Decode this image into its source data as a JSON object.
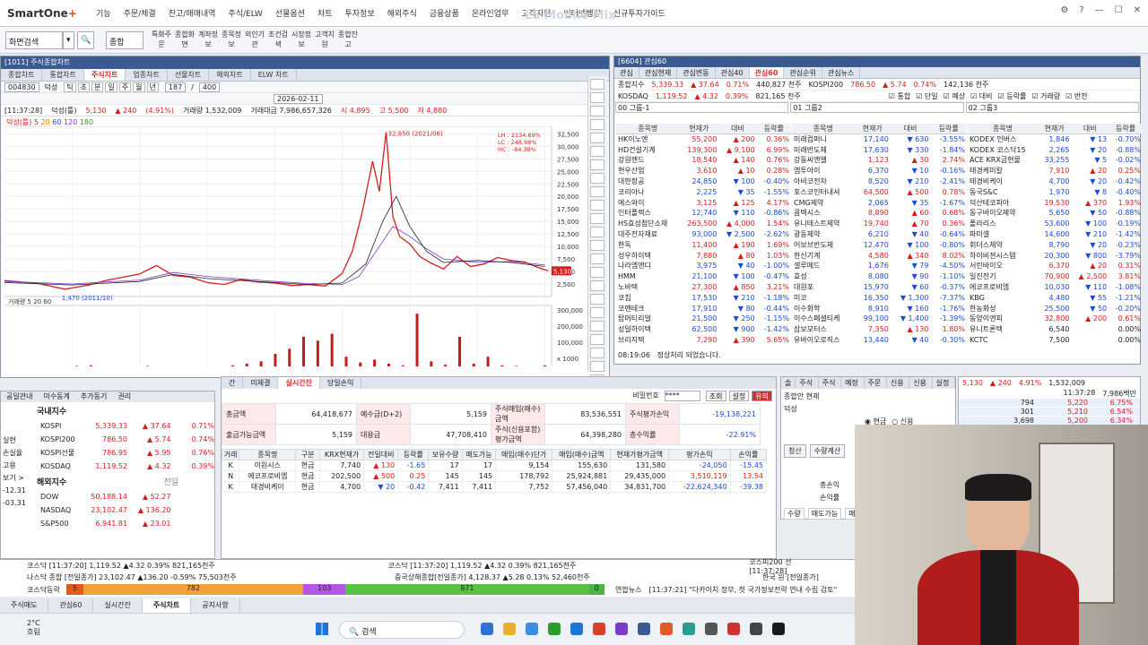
{
  "app": {
    "logo_main": "SmartOne",
    "logo_plus": "+",
    "watermark": "LS Mobile Mix",
    "menu": [
      "기능",
      "주문/체결",
      "잔고/매매내역",
      "주식/ELW",
      "선물옵션",
      "차트",
      "투자정보",
      "해외주식",
      "금융상품",
      "온라인업무",
      "고객지원",
      "인터넷뱅킹",
      "신규투자가이드"
    ]
  },
  "toolbar": {
    "screen_search": "화면검색",
    "combined": "종합",
    "buttons": [
      "특화주문",
      "종합화면",
      "계좌정보",
      "종목정보",
      "외인기관",
      "조건검색",
      "시장정보",
      "고객지원",
      "종합잔고"
    ]
  },
  "chart_window": {
    "title": "[1011] 주식종합차트",
    "tabs": [
      "종합차트",
      "통합차트",
      "주식차트",
      "업종차트",
      "선물차트",
      "해외차트",
      "ELW 차트"
    ],
    "active_tab": "주식차트",
    "stock_code": "004830",
    "stock_name": "덕성",
    "period_buttons": [
      "틱",
      "초",
      "분",
      "일",
      "주",
      "월",
      "년"
    ],
    "count": "187",
    "total": "400",
    "date": "2026-02-11",
    "time": "[11:37:28]",
    "legend": "덕성(틀)",
    "ma_legend": [
      "5",
      "20",
      "60",
      "120",
      "180"
    ],
    "price": "5,130",
    "change": "▲ 240",
    "change_pct": "(4.91%)",
    "volume_label": "거래량 1,532,009",
    "amount_label": "거래대금 7,986,657,326",
    "open": "시 4,895",
    "high": "고 5,500",
    "low": "저 4,880",
    "high_marker": "32,850 (2021/06)",
    "low_marker": "1,470 (2011/10)",
    "lh_box": [
      "LH : 2134.69%",
      "LC : 248.98%",
      "HC : -84.38%"
    ],
    "vol_legend": "거래량",
    "vol_ma": [
      "5",
      "20",
      "60"
    ]
  },
  "chart_data": {
    "type": "line",
    "title": "덕성(틀)",
    "x_ticks": [
      "2010",
      "2012",
      "2014",
      "2016",
      "2018",
      "2020",
      "2022",
      "2024",
      "2026"
    ],
    "y_ticks": [
      32500,
      30000,
      27500,
      25000,
      22500,
      20000,
      17500,
      15000,
      12500,
      10000,
      7500,
      5000,
      2500
    ],
    "vol_ticks": [
      "300,000",
      "200,000",
      "100,000",
      "x 1000"
    ],
    "ylim": [
      0,
      34000
    ],
    "series": [
      {
        "name": "덕성(틀)",
        "x": [
          2010,
          2011,
          2011.8,
          2012.5,
          2013,
          2014,
          2014.5,
          2015,
          2015.5,
          2016,
          2016.5,
          2017,
          2017.5,
          2018,
          2018.5,
          2019,
          2019.5,
          2020,
          2020.3,
          2020.6,
          2020.9,
          2021.1,
          2021.3,
          2021.5,
          2021.7,
          2022,
          2022.3,
          2022.6,
          2023,
          2023.4,
          2023.8,
          2024.2,
          2024.6,
          2025,
          2025.4,
          2025.8,
          2026.1
        ],
        "values": [
          3200,
          2600,
          1470,
          2300,
          3200,
          4500,
          6200,
          4200,
          3900,
          2800,
          2400,
          3400,
          2900,
          2700,
          2200,
          2400,
          2100,
          4600,
          9000,
          17000,
          27000,
          21000,
          32850,
          16000,
          12000,
          10500,
          8000,
          6800,
          5500,
          8000,
          6000,
          6500,
          7800,
          7200,
          6900,
          5800,
          5130
        ]
      },
      {
        "name": "120",
        "x": [
          2010,
          2012,
          2014,
          2015,
          2016,
          2018,
          2019,
          2020,
          2020.5,
          2021,
          2021.5,
          2022,
          2022.5,
          2023,
          2024,
          2025,
          2026
        ],
        "values": [
          3000,
          2500,
          3300,
          4800,
          4000,
          3000,
          2600,
          2400,
          4000,
          9000,
          14000,
          12000,
          9500,
          7500,
          6800,
          7000,
          6300
        ]
      },
      {
        "name": "60",
        "x": [
          2010,
          2012,
          2014,
          2015,
          2016,
          2018,
          2019,
          2020,
          2020.7,
          2021.2,
          2021.6,
          2022,
          2022.5,
          2023,
          2024,
          2025,
          2026
        ],
        "values": [
          2800,
          2300,
          3000,
          4400,
          3600,
          2800,
          2400,
          2700,
          6500,
          15000,
          20000,
          14000,
          9000,
          6800,
          7200,
          6800,
          6000
        ]
      }
    ],
    "volume": [
      0.02,
      0.01,
      0.02,
      0.03,
      0.02,
      0.04,
      0.05,
      0.03,
      0.02,
      0.03,
      0.04,
      0.02,
      0.03,
      0.02,
      0.03,
      0.03,
      0.05,
      0.08,
      0.12,
      0.25,
      0.34,
      0.55,
      0.48,
      0.6,
      0.2,
      0.1,
      0.15,
      0.08,
      0.05,
      0.95,
      0.12,
      0.06,
      0.55,
      0.08,
      0.2,
      0.05,
      0.04,
      0.03,
      0.05
    ]
  },
  "watch_window": {
    "title": "[6604] 관심60",
    "tabs": [
      "관심",
      "관심현재",
      "관심변동",
      "관심40",
      "관심60",
      "관심순위",
      "관심뉴스"
    ],
    "active_tab": "관심60",
    "idx1": {
      "name": "종합지수",
      "val": "5,339.33",
      "chg": "▲ 37.64",
      "pct": "0.71%",
      "vol": "440,827 천주",
      "name2": "KOSPI200",
      "val2": "786.50",
      "chg2": "▲ 5.74",
      "pct2": "0.74%",
      "vol2": "142,136 천주"
    },
    "idx2": {
      "name": "KOSDAQ",
      "val": "1,119.52",
      "chg": "▲ 4.32",
      "pct": "0.39%",
      "vol": "821,165 천주"
    },
    "options": [
      "통합",
      "단일",
      "예상",
      "대비",
      "등락률",
      "거래량",
      "반전"
    ],
    "groups": [
      "00 그룹-1",
      "01 그룹2",
      "02 그룹3"
    ],
    "headers": [
      "종목명",
      "현재가",
      "대비",
      "등락률"
    ],
    "col1": [
      [
        "HK이노엔",
        "55,200",
        "▲ 200",
        "0.36%"
      ],
      [
        "HD건설기계",
        "139,300",
        "▲ 9,100",
        "6.99%"
      ],
      [
        "강원랜드",
        "18,540",
        "▲ 140",
        "0.76%"
      ],
      [
        "현우산업",
        "3,610",
        "▲ 10",
        "0.28%"
      ],
      [
        "대한항공",
        "24,850",
        "▼ 100",
        "-0.40%"
      ],
      [
        "코리아나",
        "2,225",
        "▼ 35",
        "-1.55%"
      ],
      [
        "에스와이",
        "3,125",
        "▲ 125",
        "4.17%"
      ],
      [
        "인터플렉스",
        "12,740",
        "▼ 110",
        "-0.86%"
      ],
      [
        "HS효성첨단소재",
        "263,500",
        "▲ 4,000",
        "1.54%"
      ],
      [
        "대주전자재료",
        "93,000",
        "▼ 2,500",
        "-2.62%"
      ],
      [
        "한독",
        "11,400",
        "▲ 190",
        "1.69%"
      ],
      [
        "성우하이텍",
        "7,880",
        "▲ 80",
        "1.03%"
      ],
      [
        "나라엠앤디",
        "3,975",
        "▼ 40",
        "-1.00%"
      ],
      [
        "HMM",
        "21,100",
        "▼ 100",
        "-0.47%"
      ],
      [
        "노바텍",
        "27,300",
        "▲ 850",
        "3.21%"
      ],
      [
        "코칩",
        "17,530",
        "▼ 210",
        "-1.18%"
      ],
      [
        "코펜테크",
        "17,910",
        "▼ 80",
        "-0.44%"
      ],
      [
        "탑머티리얼",
        "21,500",
        "▼ 250",
        "-1.15%"
      ],
      [
        "성일하이텍",
        "62,500",
        "▼ 900",
        "-1.42%"
      ],
      [
        "브리지텍",
        "7,290",
        "▲ 390",
        "5.65%"
      ]
    ],
    "col2": [
      [
        "미래컴퍼니",
        "17,140",
        "▼ 630",
        "-3.55%"
      ],
      [
        "미래반도체",
        "17,630",
        "▼ 330",
        "-1.84%"
      ],
      [
        "강동씨앤엘",
        "1,123",
        "▲ 30",
        "2.74%"
      ],
      [
        "엠투아이",
        "6,370",
        "▼ 10",
        "-0.16%"
      ],
      [
        "아비코전자",
        "8,520",
        "▼ 210",
        "-2.41%"
      ],
      [
        "포스코인터내셔",
        "64,500",
        "▲ 500",
        "0.78%"
      ],
      [
        "CMG제약",
        "2,065",
        "▼ 35",
        "-1.67%"
      ],
      [
        "콤텍시스",
        "8,890",
        "▲ 60",
        "0.68%"
      ],
      [
        "유니테스트제약",
        "19,740",
        "▲ 70",
        "0.36%"
      ],
      [
        "광동제약",
        "6,210",
        "▼ 40",
        "-0.64%"
      ],
      [
        "어보브반도체",
        "12,470",
        "▼ 100",
        "-0.80%"
      ],
      [
        "한신기계",
        "4,580",
        "▲ 340",
        "8.02%"
      ],
      [
        "셀루메드",
        "1,676",
        "▼ 79",
        "-4.50%"
      ],
      [
        "효성",
        "8,080",
        "▼ 90",
        "-1.10%"
      ],
      [
        "대원포",
        "15,970",
        "▼ 60",
        "-0.37%"
      ],
      [
        "미코",
        "16,350",
        "▼ 1,300",
        "-7.37%"
      ],
      [
        "이수화학",
        "8,910",
        "▼ 160",
        "-1.76%"
      ],
      [
        "이수스페셜티케",
        "99,100",
        "▼ 1,400",
        "-1.39%"
      ],
      [
        "삼보모터스",
        "7,350",
        "▲ 130",
        "1.80%"
      ],
      [
        "유바이오로직스",
        "13,440",
        "▼ 40",
        "-0.30%"
      ]
    ],
    "col3": [
      [
        "KODEX 인버스",
        "1,846",
        "▼ 13",
        "-0.70%"
      ],
      [
        "KODEX 코스닥15",
        "2,265",
        "▼ 20",
        "-0.88%"
      ],
      [
        "ACE KRX금현물",
        "33,255",
        "▼ 5",
        "-0.02%"
      ],
      [
        "태경케미칼",
        "7,910",
        "▲ 20",
        "0.25%"
      ],
      [
        "태경비케이",
        "4,700",
        "▼ 20",
        "-0.42%"
      ],
      [
        "동국S&C",
        "1,970",
        "▼ 8",
        "-0.40%"
      ],
      [
        "덕산테코피아",
        "19,530",
        "▲ 370",
        "1.93%"
      ],
      [
        "동구바이오제약",
        "5,650",
        "▼ 50",
        "-0.88%"
      ],
      [
        "폴라리스",
        "53,600",
        "▼ 100",
        "-0.19%"
      ],
      [
        "파미셀",
        "14,600",
        "▼ 210",
        "-1.42%"
      ],
      [
        "휘더스제약",
        "8,790",
        "▼ 20",
        "-0.23%"
      ],
      [
        "하이비젼시스템",
        "20,300",
        "▼ 800",
        "-3.79%"
      ],
      [
        "서린바이오",
        "6,370",
        "▲ 20",
        "0.31%"
      ],
      [
        "일진전기",
        "70,900",
        "▲ 2,500",
        "3.81%"
      ],
      [
        "에코프로비엠",
        "10,030",
        "▼ 110",
        "-1.08%"
      ],
      [
        "KBG",
        "4,480",
        "▼ 55",
        "-1.21%"
      ],
      [
        "한농화성",
        "25,500",
        "▼ 50",
        "-0.20%"
      ],
      [
        "동양이엔피",
        "32,800",
        "▲ 200",
        "0.61%"
      ],
      [
        "유니트론텍",
        "6,540",
        "",
        "0.00%"
      ],
      [
        "KCTC",
        "7,500",
        "",
        "0.00%"
      ]
    ],
    "status_time": "08:19:06",
    "status_msg": "정상처리 되었습니다."
  },
  "left_panel": {
    "tabs": [
      "공일관내",
      "미수동계",
      "추가동기",
      "권리"
    ],
    "domestic_title": "국내지수",
    "domestic": [
      [
        "KOSPI",
        "5,339.33",
        "▲ 37.64",
        "0.71%"
      ],
      [
        "KOSPI200",
        "786.50",
        "▲ 5.74",
        "0.74%"
      ],
      [
        "KOSPI선물",
        "786.95",
        "▲ 5.95",
        "0.76%"
      ],
      [
        "KOSDAQ",
        "1,119.52",
        "▲ 4.32",
        "0.39%"
      ]
    ],
    "foreign_title": "해외지수",
    "foreign_sub": "전일",
    "foreign": [
      [
        "DOW",
        "50,188.14",
        "▲ 52.27",
        ""
      ],
      [
        "NASDAQ",
        "23,102.47",
        "▲ 136.20",
        ""
      ],
      [
        "S&P500",
        "6,941.81",
        "▲ 23.01",
        ""
      ]
    ],
    "side_labels": [
      "실현",
      "손실율",
      "고용",
      "보기 >",
      "-12.31",
      "-03.31"
    ]
  },
  "account": {
    "tabs": [
      "간",
      "미체결",
      "실시간잔",
      "당일손익"
    ],
    "active_tab": "실시간잔",
    "pw_label": "비밀번호",
    "pw_value": "****",
    "btns": [
      "조회",
      "설정",
      "유의"
    ],
    "summary": [
      [
        "총금액",
        "64,418,677",
        "예수금(D+2)",
        "5,159",
        "주식매입(매수)금액",
        "83,536,551",
        "주식평가손익",
        "-19,138,221"
      ],
      [
        "출금가능금액",
        "5,159",
        "대용금",
        "47,708,410",
        "주식(신용포함)평가금액",
        "64,398,280",
        "총수익률",
        "-22.91%"
      ]
    ],
    "headers": [
      "거래",
      "종목명",
      "구분",
      "KRX현재가",
      "전일대비",
      "등락률",
      "보유수량",
      "매도가능",
      "매입(매수)단가",
      "매입(매수)금액",
      "현재가평가금액",
      "평가손익",
      "손익률"
    ],
    "rows": [
      [
        "K",
        "이원시스",
        "현금",
        "7,740",
        "▲ 130",
        "-1.65",
        "17",
        "17",
        "9,154",
        "155,630",
        "131,580",
        "-24,050",
        "-15.45"
      ],
      [
        "N",
        "에코프로비엠",
        "현금",
        "202,500",
        "▲ 500",
        "0.25",
        "145",
        "145",
        "178,792",
        "25,924,881",
        "29,435,000",
        "3,510,119",
        "13.54"
      ],
      [
        "K",
        "태경비케이",
        "현금",
        "4,700",
        "▼ 20",
        "-0.42",
        "7,411",
        "7,411",
        "7,752",
        "57,456,040",
        "34,831,700",
        "-22,624,340",
        "-39.38"
      ]
    ]
  },
  "order": {
    "tabs": [
      "솔",
      "주식정정",
      "주식취소",
      "예정공매",
      "주문체결",
      "신용매도",
      "신용매수",
      "실정잔고"
    ],
    "label1": "종합안",
    "label2": "현재",
    "stock": "덕성",
    "radio": [
      "현금",
      "신용"
    ],
    "fields": [
      "총손익",
      "손익률"
    ],
    "btns": [
      "청산",
      "수량계산"
    ],
    "subtabs": [
      "수량",
      "매도가능",
      "매입"
    ]
  },
  "orderbook": {
    "price": "5,130",
    "chg": "▲ 240",
    "pct": "4.91%",
    "vol": "1,532,009",
    "amt": "7,986백만",
    "time": "11:37:28",
    "rows": [
      [
        "794",
        "5,220",
        "6.75%"
      ],
      [
        "301",
        "5,210",
        "6.54%"
      ],
      [
        "3,698",
        "5,200",
        "6.34%"
      ]
    ]
  },
  "ticker": {
    "r1_left": "코스닥  [11:37:20]  1,119.52 ▲4.32 0.39% 821,165천주",
    "r1_mid": "코스닥  [11:37:20]  1,119.52 ▲4.32 0.39% 821,165천주",
    "r1_right": "코스피200 선[11:37:28]",
    "r2_left": "나스닥 종합 [전일종가] 23,102.47 ▲136.20 -0.59% 75,503천주",
    "r2_mid": "중국상해종합[전일종가] 4,128.37 ▲5.28 0.13% 52,460천주",
    "r2_right": "한국 원   [전일종가]",
    "bar_label": "코스닥등락",
    "bars": [
      "5",
      "782",
      "103",
      "871",
      "0"
    ],
    "news_label": "연합뉴스",
    "news": "[11:37:21] \"다카이치 정부, 첫 국가정보전략 연내 수립 검토\""
  },
  "bottom_tabs": [
    "주식매도",
    "관심60",
    "실시간잔",
    "주식차트",
    "공지사항"
  ],
  "taskbar": {
    "temp": "2°C",
    "weather": "흐림",
    "search": "검색"
  },
  "colors": {
    "up": "#d51d1d",
    "down": "#1c49d8",
    "title": "#3b5a8f"
  }
}
